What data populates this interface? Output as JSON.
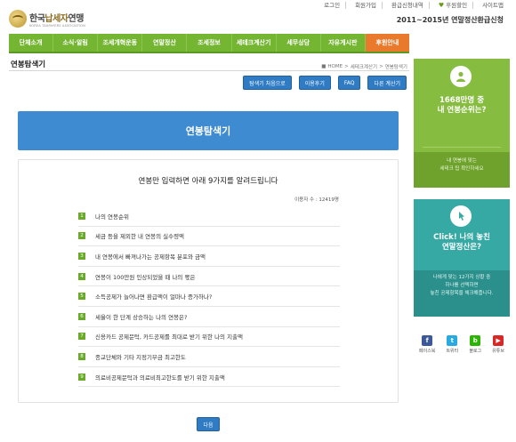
{
  "util_links": [
    "로그인",
    "회원가입",
    "환급신청내역",
    "후원할인",
    "사이트맵"
  ],
  "logo": {
    "ko_prefix": "한국",
    "ko_tx": "납세자",
    "ko_suffix": "연맹",
    "en": "KOREA TAXPAYERS ASSOCIATION"
  },
  "promo": {
    "text": "2011~2015년 연말정산환급신청"
  },
  "nav": [
    "단체소개",
    "소식·알림",
    "조세개혁운동",
    "연말정산",
    "조세정보",
    "세테크계산기",
    "세무상담",
    "자유게시판",
    "후원안내"
  ],
  "page_title": "연봉탐색기",
  "breadcrumb": [
    "HOME",
    "세테크계산기",
    "연봉탐색기"
  ],
  "buttons": [
    "탐색기 처음으로",
    "이용후기",
    "FAQ",
    "다른 계산기"
  ],
  "hero_title": "연봉탐색기",
  "box_title": "연봉만 입력하면 아래 9가지를 알려드립니다",
  "users": "이용자 수 : 12419명",
  "items": [
    {
      "num": "1",
      "text": "나의 연봉순위"
    },
    {
      "num": "2",
      "text": "세금 등을 제외한 내 연봉의 실수령액"
    },
    {
      "num": "3",
      "text": "내 연봉에서 빠져나가는 공제항목 분포와 금액"
    },
    {
      "num": "4",
      "text": "연봉이 100만원 인상되었을 때 나의 몫은"
    },
    {
      "num": "5",
      "text": "소득공제가 늘어나면 환급액이 얼마나 증가하나?"
    },
    {
      "num": "6",
      "text": "세율이 한 단계 상승하는 나의 연봉은?"
    },
    {
      "num": "7",
      "text": "신용카드 공제문턱, 카드공제를 최대로 받기 위한 나의 지출액"
    },
    {
      "num": "8",
      "text": "종교단체와 기타 지정기부금 최고한도"
    },
    {
      "num": "9",
      "text": "의료비공제문턱과 의료비최고한도를 받기 위한 지출액"
    }
  ],
  "next_button": "다음",
  "side": {
    "card1_head": [
      "1668만명 중",
      "내 연봉순위는?"
    ],
    "card1_sub": [
      "내 연봉에 맞는",
      "세테크 팁 확인하세요"
    ],
    "card2_head": [
      "Click! 나의 놓친",
      "연말정산은?"
    ],
    "card2_sub": [
      "나에게 맞는 12가지 상황 중",
      "하나를 선택하면",
      "놓친 공제항목을 체크해줍니다."
    ],
    "social": [
      {
        "label": "페이스북",
        "glyph": "f",
        "color": "#3b5998"
      },
      {
        "label": "트위터",
        "glyph": "t",
        "color": "#29a9e1"
      },
      {
        "label": "블로그",
        "glyph": "b",
        "color": "#2db400"
      },
      {
        "label": "유튜브",
        "glyph": "▶",
        "color": "#d92626"
      }
    ]
  },
  "colors": {
    "nav": "#74b532",
    "nav_active": "#e9792b",
    "accent_blue": "#3e8bd2",
    "num_badge": "#69aa2a"
  }
}
